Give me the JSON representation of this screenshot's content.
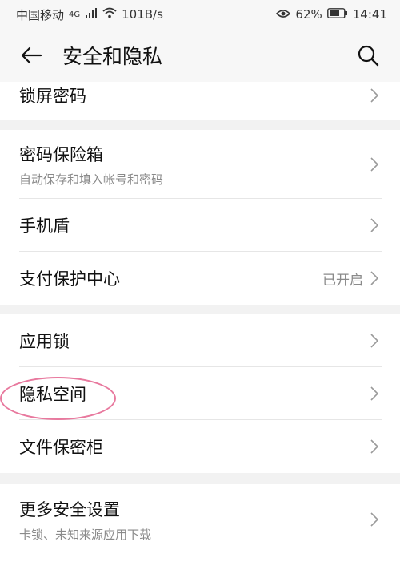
{
  "status": {
    "carrier": "中国移动",
    "net_type": "4G",
    "speed": "101B/s",
    "battery": "62%",
    "time": "14:41"
  },
  "header": {
    "title": "安全和隐私"
  },
  "groups": [
    {
      "rows": [
        {
          "label": "锁屏密码"
        }
      ]
    },
    {
      "rows": [
        {
          "label": "密码保险箱",
          "sub": "自动保存和填入帐号和密码"
        },
        {
          "label": "手机盾"
        },
        {
          "label": "支付保护中心",
          "value": "已开启"
        }
      ]
    },
    {
      "rows": [
        {
          "label": "应用锁"
        },
        {
          "label": "隐私空间"
        },
        {
          "label": "文件保密柜"
        }
      ]
    },
    {
      "rows": [
        {
          "label": "更多安全设置",
          "sub": "卡锁、未知来源应用下载"
        }
      ]
    }
  ],
  "colors": {
    "highlight_circle": "#e8799e",
    "background": "#f2f2f2"
  }
}
